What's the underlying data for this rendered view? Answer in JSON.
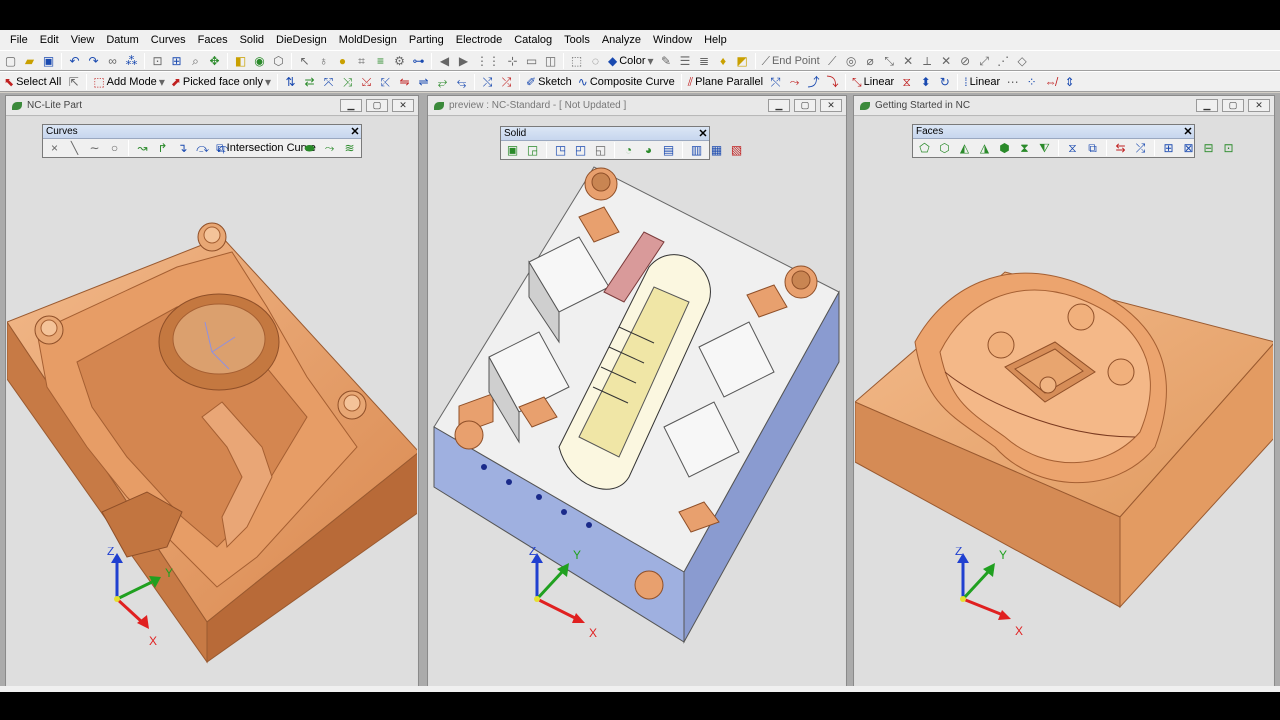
{
  "menu": [
    "File",
    "Edit",
    "View",
    "Datum",
    "Curves",
    "Faces",
    "Solid",
    "DieDesign",
    "MoldDesign",
    "Parting",
    "Electrode",
    "Catalog",
    "Tools",
    "Analyze",
    "Window",
    "Help"
  ],
  "toolbar1": {
    "color_label": "Color",
    "end_point_label": "End Point"
  },
  "toolbar2": {
    "select_all_label": "Select All",
    "add_mode_label": "Add Mode",
    "picked_face_label": "Picked face only",
    "sketch_label": "Sketch",
    "composite_curve_label": "Composite Curve",
    "plane_parallel_label": "Plane Parallel",
    "linear_label_1": "Linear",
    "linear_label_2": "Linear"
  },
  "windows": [
    {
      "title": "NC-Lite Part",
      "toolbar_title": "Curves",
      "toolbar_label": "Intersection Curve"
    },
    {
      "title": "preview : NC-Standard - [ Not Updated ]",
      "toolbar_title": "Solid"
    },
    {
      "title": "Getting Started in NC",
      "toolbar_title": "Faces"
    }
  ],
  "triad": {
    "x": "X",
    "y": "Y",
    "z": "Z"
  },
  "colors": {
    "copper": "#e8a06e",
    "copper_dark": "#b8693a",
    "mold_blue": "#9fb0e0",
    "axis_x": "#e02020",
    "axis_y": "#20a020",
    "axis_z": "#2040d0"
  }
}
